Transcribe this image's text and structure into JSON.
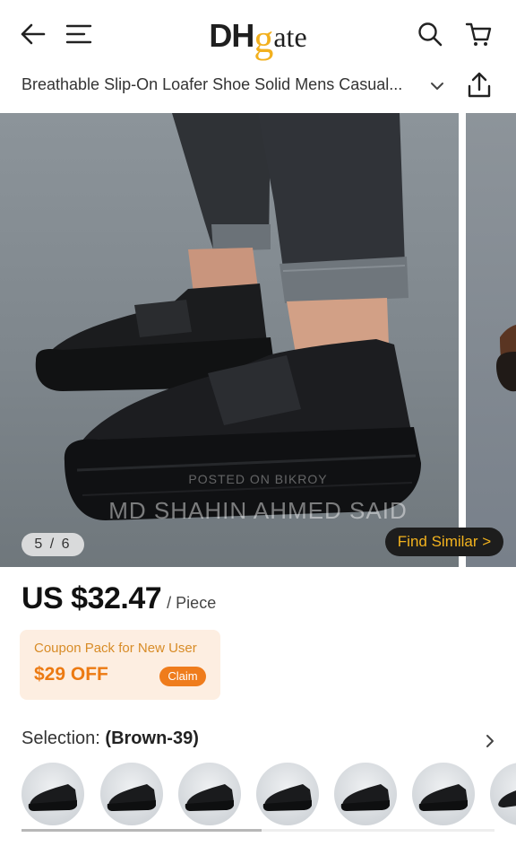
{
  "header": {
    "logo": {
      "part1": "DH",
      "part2": "g",
      "part3": "ate"
    },
    "icons": [
      "back-arrow-icon",
      "menu-icon",
      "search-icon",
      "cart-icon"
    ]
  },
  "product": {
    "title": "Breathable Slip-On Loafer Shoe Solid Mens Casual...",
    "price": "US $32.47",
    "unit": "/ Piece"
  },
  "gallery": {
    "counter": "5 / 6",
    "find_similar": "Find Similar >",
    "watermark_line1": "POSTED ON BIKROY",
    "watermark_line2": "MD SHAHIN AHMED SAID"
  },
  "coupon": {
    "title": "Coupon Pack for New User",
    "amount": "$29 OFF",
    "claim": "Claim"
  },
  "selection": {
    "label": "Selection:",
    "value": "(Brown-39)",
    "thumbnail_count": 7
  },
  "colors": {
    "accent_gold": "#f2b01e",
    "coupon_orange": "#ec7a12",
    "coupon_bg": "#fdeee1",
    "find_similar_text": "#f3b31e"
  }
}
